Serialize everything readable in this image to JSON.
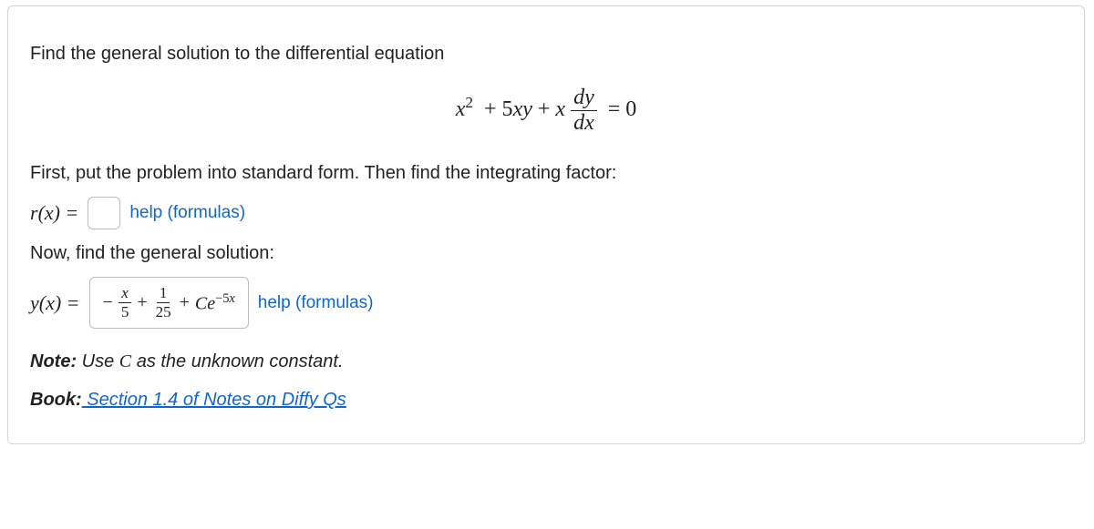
{
  "problem": {
    "intro": "Find the general solution to the differential equation",
    "equation_html": "x² + 5xy + x (dy/dx) = 0",
    "step1": "First, put the problem into standard form. Then find the integrating factor:",
    "r_label": "r(x) =",
    "r_value": "",
    "step2": "Now, find the general solution:",
    "y_label": "y(x) =",
    "y_value_html": "− x/5 + 1/25 + Ce^{-5x}",
    "note_prefix": "Note:",
    "note_text": " Use C as the unknown constant.",
    "book_prefix": "Book:",
    "book_text": " Section 1.4 of Notes on Diffy Qs",
    "help_text": "help (formulas)"
  }
}
